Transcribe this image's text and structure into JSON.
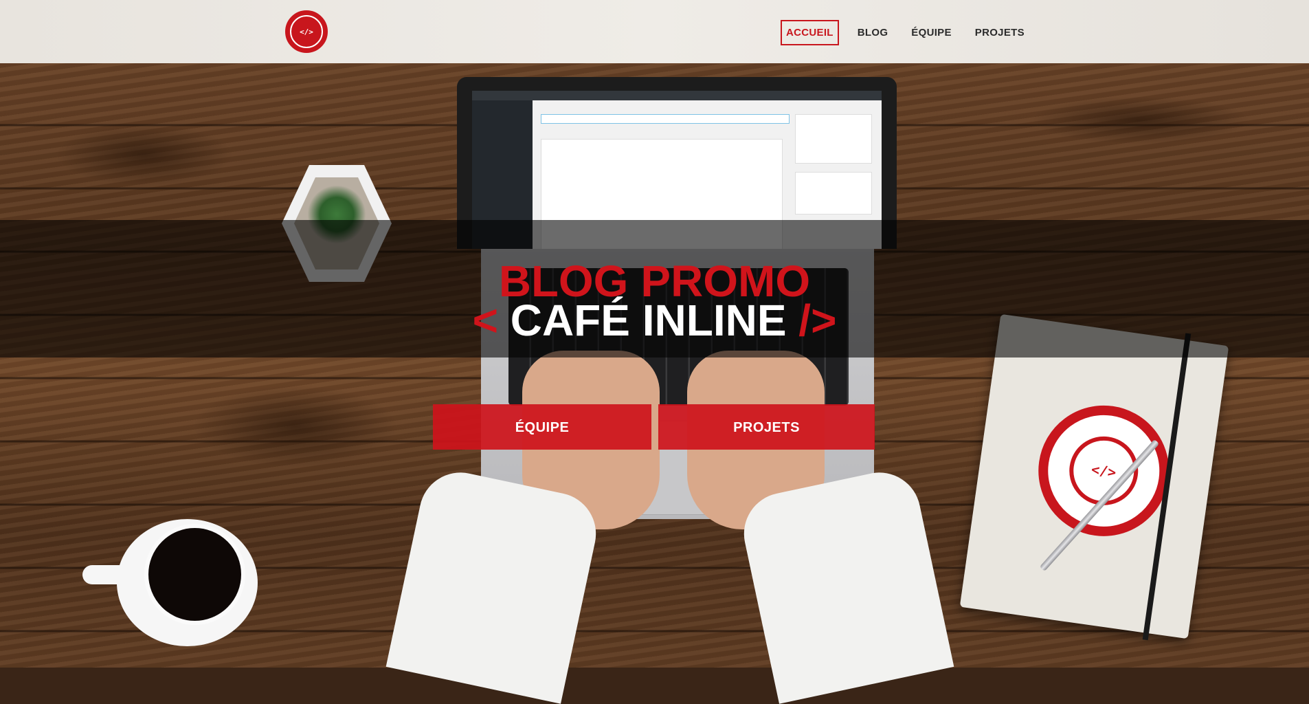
{
  "header": {
    "logo_alt": "CAFÉINLINE PROMO",
    "logo_symbol": "</>",
    "nav": [
      {
        "label": "ACCUEIL",
        "active": true
      },
      {
        "label": "BLOG",
        "active": false
      },
      {
        "label": "ÉQUIPE",
        "active": false
      },
      {
        "label": "PROJETS",
        "active": false
      }
    ]
  },
  "hero": {
    "title": "BLOG PROMO",
    "subtitle_open": "<",
    "subtitle_text": "CAFÉ INLINE",
    "subtitle_close": "/>",
    "buttons": [
      {
        "label": "ÉQUIPE"
      },
      {
        "label": "PROJETS"
      }
    ]
  },
  "colors": {
    "accent": "#c8161d",
    "header_bg": "#efece7",
    "band_overlay": "rgba(0,0,0,0.58)"
  },
  "icons": {
    "logo": "cafeinline-promo-logo"
  }
}
